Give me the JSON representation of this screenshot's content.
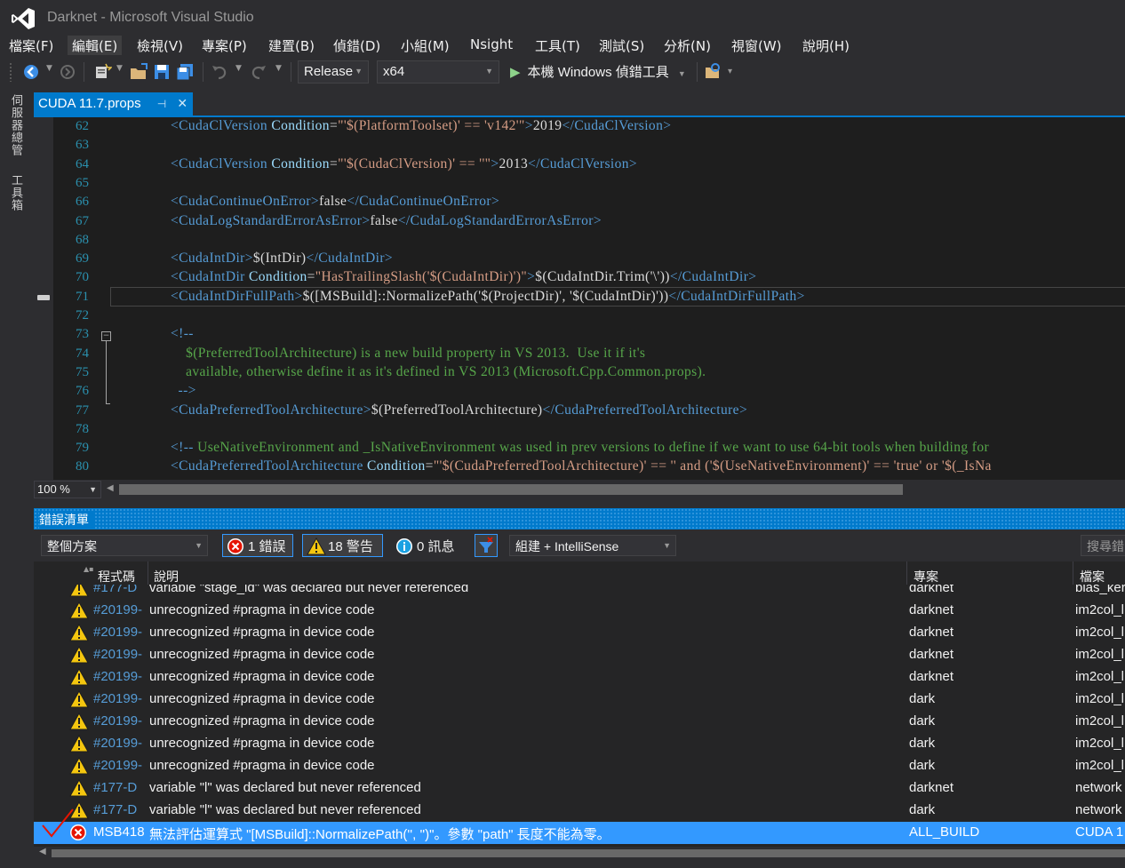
{
  "window": {
    "title": "Darknet - Microsoft Visual Studio"
  },
  "menu": [
    "檔案(F)",
    "編輯(E)",
    "檢視(V)",
    "專案(P)",
    "建置(B)",
    "偵錯(D)",
    "小組(M)",
    "Nsight",
    "工具(T)",
    "測試(S)",
    "分析(N)",
    "視窗(W)",
    "說明(H)"
  ],
  "toolbar": {
    "configuration": "Release",
    "platform": "x64",
    "start_debugger": "本機 Windows 偵錯工具"
  },
  "side_tabs": [
    "伺服器總管",
    "工具箱"
  ],
  "document_tab": {
    "name": "CUDA 11.7.props"
  },
  "editor": {
    "lines": [
      {
        "n": "62",
        "html": "<span class=\"t\">&lt;CudaClVersion</span> <span class=\"a\">Condition</span>=<span class=\"s\">\"'$(PlatformToolset)' == 'v142'\"</span><span class=\"t\">&gt;</span>2019<span class=\"t\">&lt;/CudaClVersion&gt;</span>"
      },
      {
        "n": "63",
        "html": ""
      },
      {
        "n": "64",
        "html": "<span class=\"t\">&lt;CudaClVersion</span> <span class=\"a\">Condition</span>=<span class=\"s\">\"'$(CudaClVersion)' == ''\"</span><span class=\"t\">&gt;</span>2013<span class=\"t\">&lt;/CudaClVersion&gt;</span>"
      },
      {
        "n": "65",
        "html": ""
      },
      {
        "n": "66",
        "html": "<span class=\"t\">&lt;CudaContinueOnError&gt;</span>false<span class=\"t\">&lt;/CudaContinueOnError&gt;</span>"
      },
      {
        "n": "67",
        "html": "<span class=\"t\">&lt;CudaLogStandardErrorAsError&gt;</span>false<span class=\"t\">&lt;/CudaLogStandardErrorAsError&gt;</span>"
      },
      {
        "n": "68",
        "html": ""
      },
      {
        "n": "69",
        "html": "<span class=\"t\">&lt;CudaIntDir&gt;</span>$(IntDir)<span class=\"t\">&lt;/CudaIntDir&gt;</span>"
      },
      {
        "n": "70",
        "html": "<span class=\"t\">&lt;CudaIntDir</span> <span class=\"a\">Condition</span>=<span class=\"s\">\"HasTrailingSlash('$(CudaIntDir)')\"</span><span class=\"t\">&gt;</span>$(CudaIntDir.Trim('\\'))<span class=\"t\">&lt;/CudaIntDir&gt;</span>"
      },
      {
        "n": "71",
        "html": "<span class=\"t\">&lt;CudaIntDirFullPath&gt;</span>$([MSBuild]::NormalizePath('$(ProjectDir)', '$(CudaIntDir)'))<span class=\"t\">&lt;/CudaIntDirFullPath&gt;</span>"
      },
      {
        "n": "72",
        "html": ""
      },
      {
        "n": "73",
        "html": "<span class=\"t\">&lt;!--</span>"
      },
      {
        "n": "74",
        "html": "<span class=\"c\">    $(PreferredToolArchitecture) is a new build property in VS 2013.  Use it if it's</span>"
      },
      {
        "n": "75",
        "html": "<span class=\"c\">    available, otherwise define it as it's defined in VS 2013 (Microsoft.Cpp.Common.props).</span>"
      },
      {
        "n": "76",
        "html": "<span class=\"t\">  --&gt;</span>"
      },
      {
        "n": "77",
        "html": "<span class=\"t\">&lt;CudaPreferredToolArchitecture&gt;</span>$(PreferredToolArchitecture)<span class=\"t\">&lt;/CudaPreferredToolArchitecture&gt;</span>"
      },
      {
        "n": "78",
        "html": ""
      },
      {
        "n": "79",
        "html": "<span class=\"t\">&lt;!--</span><span class=\"c\"> UseNativeEnvironment and _IsNativeEnvironment was used in prev versions to define if we want to use 64-bit tools when building for</span>"
      },
      {
        "n": "80",
        "html": "<span class=\"t\">&lt;CudaPreferredToolArchitecture</span> <span class=\"a\">Condition</span>=<span class=\"s\">\"'$(CudaPreferredToolArchitecture)' == '' and ('$(UseNativeEnvironment)' == 'true' or '$(_IsNa</span>"
      }
    ],
    "zoom": "100 %"
  },
  "error_list": {
    "title": "錯誤清單",
    "scope": "整個方案",
    "errors_btn": "1 錯誤",
    "warnings_btn": "18 警告",
    "messages_btn": "0 訊息",
    "build_filter": "組建 + IntelliSense",
    "search_placeholder": "搜尋錯",
    "columns": {
      "code": "程式碼",
      "desc": "說明",
      "project": "專案",
      "file": "檔案"
    },
    "rows": [
      {
        "kind": "warning",
        "code": "#177-D",
        "desc": "variable \"stage_id\" was declared but never referenced",
        "project": "darknet",
        "file": "blas_ker"
      },
      {
        "kind": "warning",
        "code": "#20199-",
        "desc": "unrecognized #pragma in device code",
        "project": "darknet",
        "file": "im2col_l"
      },
      {
        "kind": "warning",
        "code": "#20199-",
        "desc": "unrecognized #pragma in device code",
        "project": "darknet",
        "file": "im2col_l"
      },
      {
        "kind": "warning",
        "code": "#20199-",
        "desc": "unrecognized #pragma in device code",
        "project": "darknet",
        "file": "im2col_l"
      },
      {
        "kind": "warning",
        "code": "#20199-",
        "desc": "unrecognized #pragma in device code",
        "project": "darknet",
        "file": "im2col_l"
      },
      {
        "kind": "warning",
        "code": "#20199-",
        "desc": "unrecognized #pragma in device code",
        "project": "dark",
        "file": "im2col_l"
      },
      {
        "kind": "warning",
        "code": "#20199-",
        "desc": "unrecognized #pragma in device code",
        "project": "dark",
        "file": "im2col_l"
      },
      {
        "kind": "warning",
        "code": "#20199-",
        "desc": "unrecognized #pragma in device code",
        "project": "dark",
        "file": "im2col_l"
      },
      {
        "kind": "warning",
        "code": "#20199-",
        "desc": "unrecognized #pragma in device code",
        "project": "dark",
        "file": "im2col_l"
      },
      {
        "kind": "warning",
        "code": "#177-D",
        "desc": "variable \"l\" was declared but never referenced",
        "project": "darknet",
        "file": "network"
      },
      {
        "kind": "warning",
        "code": "#177-D",
        "desc": "variable \"l\" was declared but never referenced",
        "project": "dark",
        "file": "network"
      },
      {
        "kind": "error",
        "code": "MSB418",
        "desc": "無法評估運算式 \"[MSBuild]::NormalizePath('', '')\"。參數 \"path\" 長度不能為零。",
        "project": "ALL_BUILD",
        "file": "CUDA 1",
        "selected": true
      }
    ]
  },
  "colors": {
    "accent": "#007acc",
    "selection": "#3399ff",
    "warning": "#f4c60f",
    "error": "#e51400"
  }
}
